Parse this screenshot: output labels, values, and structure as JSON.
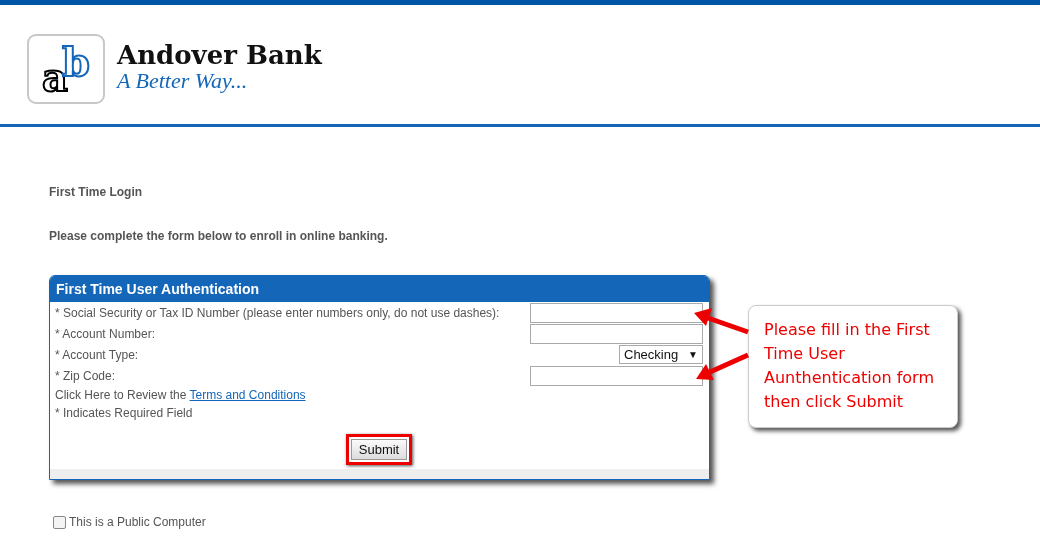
{
  "logo": {
    "letters": [
      "a",
      "b"
    ],
    "name": "Andover Bank",
    "tagline": "A Better Way..."
  },
  "heading": "First Time Login",
  "intro": "Please complete the form below to enroll in online banking.",
  "form": {
    "title": "First Time User Authentication",
    "fields": [
      {
        "kind": "text",
        "label": "* Social Security or Tax ID Number (please enter numbers only, do not use dashes):"
      },
      {
        "kind": "text",
        "label": "* Account Number:"
      },
      {
        "kind": "select",
        "label": "* Account Type:",
        "value": "Checking",
        "caret": "▼"
      },
      {
        "kind": "text",
        "label": "* Zip Code:"
      }
    ],
    "terms_prefix": "Click Here to Review the",
    "terms_link": "Terms and Conditions",
    "required_note": "* Indicates Required Field",
    "submit": "Submit"
  },
  "public_computer": {
    "label": "This is a Public Computer",
    "checked": false
  },
  "callout": "Please fill in the First Time User Aunthentication form then click Submit"
}
